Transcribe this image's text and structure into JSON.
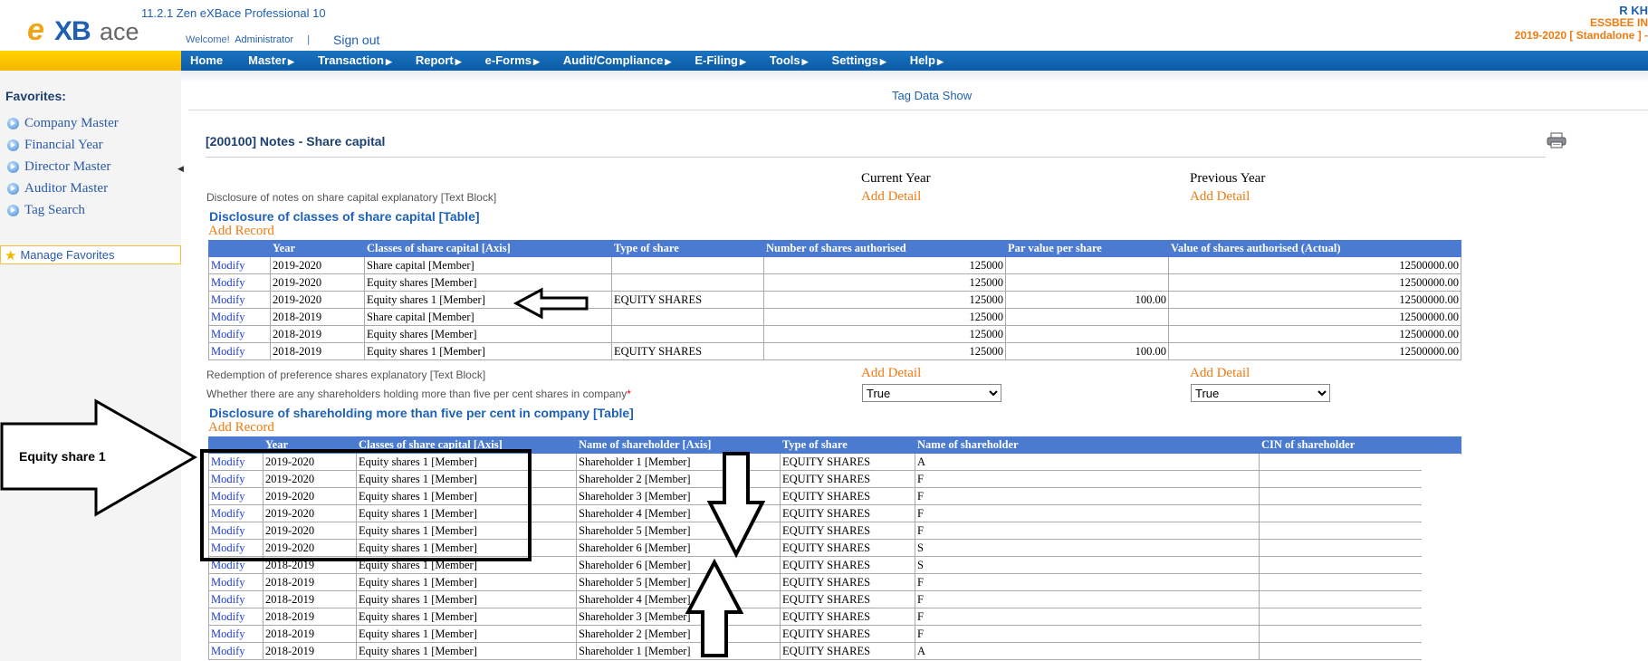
{
  "header": {
    "logo_e": "e",
    "logo_xb": "XB",
    "logo_ace": "ace",
    "product": "11.2.1 Zen eXBace Professional 10",
    "welcome_label": "Welcome!",
    "user": "Administrator",
    "separator": "|",
    "signout": "Sign out",
    "right_user": "R KH",
    "right_company": "ESSBEE IN",
    "right_year": "2019-2020 [ Standalone ] -"
  },
  "nav": [
    {
      "label": "Home",
      "arrow": ""
    },
    {
      "label": "Master",
      "arrow": "▶"
    },
    {
      "label": "Transaction",
      "arrow": "▶"
    },
    {
      "label": "Report",
      "arrow": "▶"
    },
    {
      "label": "e-Forms",
      "arrow": "▶"
    },
    {
      "label": "Audit/Compliance",
      "arrow": "▶"
    },
    {
      "label": "E-Filing",
      "arrow": "▶"
    },
    {
      "label": "Tools",
      "arrow": "▶"
    },
    {
      "label": "Settings",
      "arrow": "▶"
    },
    {
      "label": "Help",
      "arrow": "▶"
    }
  ],
  "sidebar": {
    "title": "Favorites:",
    "items": [
      "Company Master",
      "Financial Year",
      "Director Master",
      "Auditor Master",
      "Tag Search"
    ],
    "manage": "Manage Favorites"
  },
  "content": {
    "tag_data_show": "Tag Data Show",
    "notes_title": "[200100] Notes - Share capital",
    "current_year": "Current Year",
    "previous_year": "Previous Year",
    "add_detail": "Add Detail",
    "disclosure_notes_label": "Disclosure of notes on share capital explanatory [Text Block]",
    "section1_title": "Disclosure of classes of share capital [Table]",
    "add_record": "Add Record",
    "redemption_label": "Redemption of preference shares explanatory [Text Block]",
    "whether_label": "Whether there are any shareholders holding more than five per cent shares in company",
    "required_mark": "*",
    "select_current": "True",
    "select_previous": "True",
    "section2_title": "Disclosure of shareholding more than five per cent in company [Table]"
  },
  "table1": {
    "headers": [
      "",
      "Year",
      "Classes of share capital [Axis]",
      "Type of share",
      "Number of shares authorised",
      "Par value per share",
      "Value of shares authorised (Actual)"
    ],
    "rows": [
      [
        "Modify",
        "2019-2020",
        "Share capital [Member]",
        "",
        "125000",
        "",
        "12500000.00"
      ],
      [
        "Modify",
        "2019-2020",
        "Equity shares [Member]",
        "",
        "125000",
        "",
        "12500000.00"
      ],
      [
        "Modify",
        "2019-2020",
        "Equity shares 1 [Member]",
        "EQUITY SHARES",
        "125000",
        "100.00",
        "12500000.00"
      ],
      [
        "Modify",
        "2018-2019",
        "Share capital [Member]",
        "",
        "125000",
        "",
        "12500000.00"
      ],
      [
        "Modify",
        "2018-2019",
        "Equity shares [Member]",
        "",
        "125000",
        "",
        "12500000.00"
      ],
      [
        "Modify",
        "2018-2019",
        "Equity shares 1 [Member]",
        "EQUITY SHARES",
        "125000",
        "100.00",
        "12500000.00"
      ]
    ]
  },
  "table2": {
    "headers": [
      "",
      "Year",
      "Classes of share capital [Axis]",
      "Name of shareholder [Axis]",
      "Type of share",
      "Name of shareholder",
      "CIN of shareholder"
    ],
    "rows": [
      [
        "Modify",
        "2019-2020",
        "Equity shares 1 [Member]",
        "Shareholder 1 [Member]",
        "EQUITY SHARES",
        "A",
        ""
      ],
      [
        "Modify",
        "2019-2020",
        "Equity shares 1 [Member]",
        "Shareholder 2 [Member]",
        "EQUITY SHARES",
        "F",
        ""
      ],
      [
        "Modify",
        "2019-2020",
        "Equity shares 1 [Member]",
        "Shareholder 3 [Member]",
        "EQUITY SHARES",
        "F",
        ""
      ],
      [
        "Modify",
        "2019-2020",
        "Equity shares 1 [Member]",
        "Shareholder 4 [Member]",
        "EQUITY SHARES",
        "F",
        ""
      ],
      [
        "Modify",
        "2019-2020",
        "Equity shares 1 [Member]",
        "Shareholder 5 [Member]",
        "EQUITY SHARES",
        "F",
        ""
      ],
      [
        "Modify",
        "2019-2020",
        "Equity shares 1 [Member]",
        "Shareholder 6 [Member]",
        "EQUITY SHARES",
        "S",
        ""
      ],
      [
        "Modify",
        "2018-2019",
        "Equity shares 1 [Member]",
        "Shareholder 6 [Member]",
        "EQUITY SHARES",
        "S",
        ""
      ],
      [
        "Modify",
        "2018-2019",
        "Equity shares 1 [Member]",
        "Shareholder 5 [Member]",
        "EQUITY SHARES",
        "F",
        ""
      ],
      [
        "Modify",
        "2018-2019",
        "Equity shares 1 [Member]",
        "Shareholder 4 [Member]",
        "EQUITY SHARES",
        "F",
        ""
      ],
      [
        "Modify",
        "2018-2019",
        "Equity shares 1 [Member]",
        "Shareholder 3 [Member]",
        "EQUITY SHARES",
        "F",
        ""
      ],
      [
        "Modify",
        "2018-2019",
        "Equity shares 1 [Member]",
        "Shareholder 2 [Member]",
        "EQUITY SHARES",
        "F",
        ""
      ],
      [
        "Modify",
        "2018-2019",
        "Equity shares 1 [Member]",
        "Shareholder 1 [Member]",
        "EQUITY SHARES",
        "A",
        ""
      ]
    ]
  },
  "annotation": {
    "label": "Equity share 1"
  },
  "icons": {
    "printer": "printer-icon",
    "fav_bullet": "circle-arrow-icon",
    "star": "star-icon"
  },
  "colors": {
    "nav_blue": "#0b5aa6",
    "nav_yellow": "#f7b500",
    "table_header": "#4a7bd0",
    "link_orange": "#f07a10",
    "title_blue": "#1e62b8"
  }
}
